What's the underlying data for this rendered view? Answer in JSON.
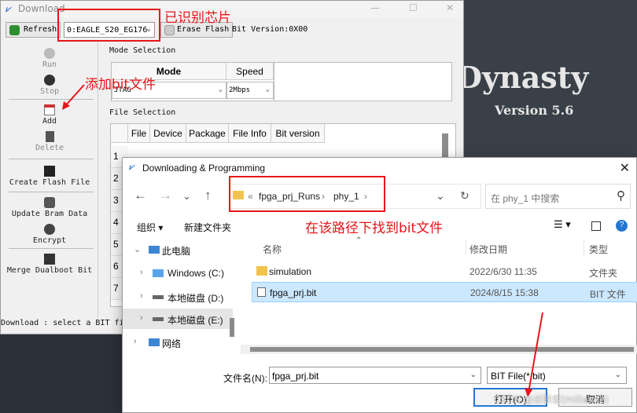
{
  "splash": {
    "title": "Dynasty",
    "version": "Version 5.6"
  },
  "download_window": {
    "title": "Download",
    "toolbar": {
      "refresh_label": "Refresh",
      "device_combo": "0:EAGLE_S20_EG176",
      "erase_flash_label": "Erase Flash",
      "bit_version": "Bit Version:0X00"
    },
    "left_panel": {
      "run": "Run",
      "stop": "Stop",
      "add": "Add",
      "delete": "Delete",
      "create_flash_file": "Create Flash File",
      "update_bram_data": "Update Bram Data",
      "encrypt": "Encrypt",
      "merge_dualboot_bit": "Merge Dualboot Bit"
    },
    "mode_selection": {
      "title": "Mode Selection",
      "mode_header": "Mode",
      "speed_header": "Speed",
      "mode_value": "JTAG",
      "speed_value": "2Mbps"
    },
    "file_selection": {
      "title": "File Selection",
      "columns": [
        "File",
        "Device",
        "Package",
        "File Info",
        "Bit version"
      ],
      "row_numbers": [
        "1",
        "2",
        "3",
        "4",
        "5",
        "6",
        "7"
      ]
    },
    "status": "Download : select a BIT file"
  },
  "annotations": {
    "device_recognized": "已识别芯片",
    "add_bit_file": "添加bit文件",
    "find_bit_in_path": "在该路径下找到bit文件"
  },
  "dialog": {
    "title": "Downloading & Programming",
    "address": {
      "overflow": "«",
      "crumbs": [
        "fpga_prj_Runs",
        "phy_1"
      ]
    },
    "search_placeholder": "在 phy_1 中搜索",
    "toolbar": {
      "organize": "组织 ▾",
      "new_folder": "新建文件夹"
    },
    "nav": [
      {
        "label": "此电脑"
      },
      {
        "label": "Windows (C:)"
      },
      {
        "label": "本地磁盘 (D:)"
      },
      {
        "label": "本地磁盘 (E:)"
      },
      {
        "label": "网络"
      }
    ],
    "columns": {
      "name": "名称",
      "date": "修改日期",
      "type": "类型"
    },
    "files": [
      {
        "name": "simulation",
        "date": "2022/6/30 11:35",
        "type": "文件夹"
      },
      {
        "name": "fpga_prj.bit",
        "date": "2024/8/15 15:38",
        "type": "BIT 文件"
      }
    ],
    "filename_label": "文件名(N):",
    "filename_value": "fpga_prj.bit",
    "filetype_value": "BIT File(*.bit)",
    "open_button": "打开(O)",
    "cancel_button": "取消"
  },
  "watermark": "CSDN @米联客(milianke)",
  "colors": {
    "annotation_red": "#e6161a",
    "selection_blue": "#cce8ff",
    "primary_border": "#2377d1"
  }
}
